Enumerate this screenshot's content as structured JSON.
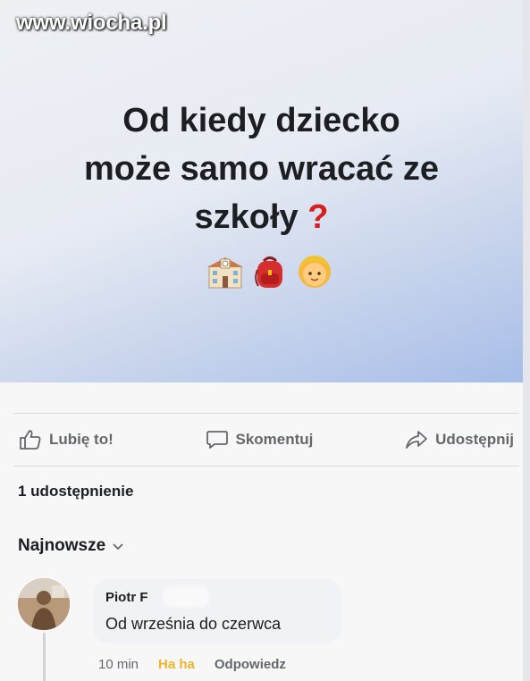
{
  "watermark": "www.wiocha.pl",
  "post": {
    "text_lines": [
      "Od kiedy dziecko",
      "może samo wracać ze",
      "szkoły"
    ],
    "question_mark": "?",
    "emojis": [
      "school-emoji",
      "backpack-emoji",
      "child-emoji"
    ]
  },
  "actions": {
    "like_label": "Lubię to!",
    "comment_label": "Skomentuj",
    "share_label": "Udostępnij"
  },
  "shares_count_text": "1 udostępnienie",
  "comments_sort": {
    "label": "Najnowsze"
  },
  "comment": {
    "author": "Piotr F",
    "text": "Od września do czerwca",
    "time": "10 min",
    "reaction": "Ha ha",
    "reply_label": "Odpowiedz"
  },
  "colors": {
    "question_mark": "#d61f1f",
    "haha_reaction": "#f0b429",
    "secondary_text": "#65676b",
    "primary_text": "#1c1e21",
    "bubble_bg": "#f0f2f5"
  }
}
